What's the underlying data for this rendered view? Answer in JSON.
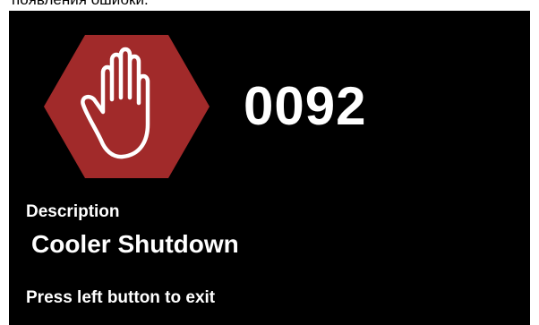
{
  "caption": {
    "text": "появления ошибки."
  },
  "error": {
    "icon": "stop-hand-icon",
    "icon_color": "#a12a2a",
    "code": "0092"
  },
  "description": {
    "label": "Description",
    "value": "Cooler Shutdown"
  },
  "footer": {
    "hint": "Press left button to exit"
  }
}
